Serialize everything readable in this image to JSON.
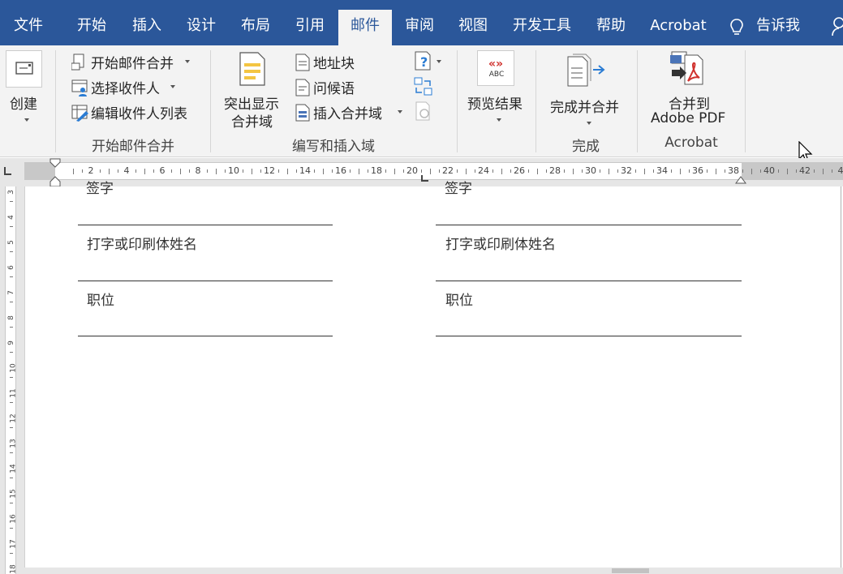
{
  "tabs": [
    {
      "label": "文件",
      "active": false
    },
    {
      "label": "开始",
      "active": false
    },
    {
      "label": "插入",
      "active": false
    },
    {
      "label": "设计",
      "active": false
    },
    {
      "label": "布局",
      "active": false
    },
    {
      "label": "引用",
      "active": false
    },
    {
      "label": "邮件",
      "active": true
    },
    {
      "label": "审阅",
      "active": false
    },
    {
      "label": "视图",
      "active": false
    },
    {
      "label": "开发工具",
      "active": false
    },
    {
      "label": "帮助",
      "active": false
    },
    {
      "label": "Acrobat",
      "active": false
    }
  ],
  "tell_me": {
    "label": "告诉我",
    "icon": "lightbulb-icon"
  },
  "ribbon": {
    "create": {
      "label": "创建"
    },
    "start_mail_merge_group": {
      "label": "开始邮件合并",
      "start_mail_merge": "开始邮件合并",
      "select_recipients": "选择收件人",
      "edit_recipient_list": "编辑收件人列表"
    },
    "write_insert_group": {
      "label": "编写和插入域",
      "highlight_fields_line1": "突出显示",
      "highlight_fields_line2": "合并域",
      "address_block": "地址块",
      "greeting_line": "问候语",
      "insert_merge_field": "插入合并域"
    },
    "preview_group": {
      "preview_results": "预览结果",
      "icon_text": "ABC"
    },
    "finish_group": {
      "label": "完成",
      "finish_merge": "完成并合并"
    },
    "acrobat_group": {
      "label": "Acrobat",
      "merge_pdf_line1": "合并到",
      "merge_pdf_line2": "Adobe PDF"
    }
  },
  "ruler": {
    "numbers": [
      "2",
      "4",
      "6",
      "8",
      "10",
      "12",
      "14",
      "16",
      "18",
      "20",
      "22",
      "24",
      "26",
      "28",
      "30",
      "32",
      "34",
      "36",
      "38",
      "40",
      "42",
      "4"
    ],
    "vertical_numbers": [
      "3",
      "4",
      "5",
      "6",
      "7",
      "8",
      "9",
      "10",
      "11",
      "12",
      "13",
      "14",
      "15",
      "16",
      "17",
      "18"
    ]
  },
  "document": {
    "left_column": {
      "top_cut": "签字",
      "printed_name": "打字或印刷体姓名",
      "position": "职位"
    },
    "right_column": {
      "top_cut": "签字",
      "printed_name": "打字或印刷体姓名",
      "position": "职位"
    }
  },
  "colors": {
    "accent": "#2b579a",
    "ribbon_bg": "#f3f3f3",
    "pdf_red": "#d0312d"
  }
}
